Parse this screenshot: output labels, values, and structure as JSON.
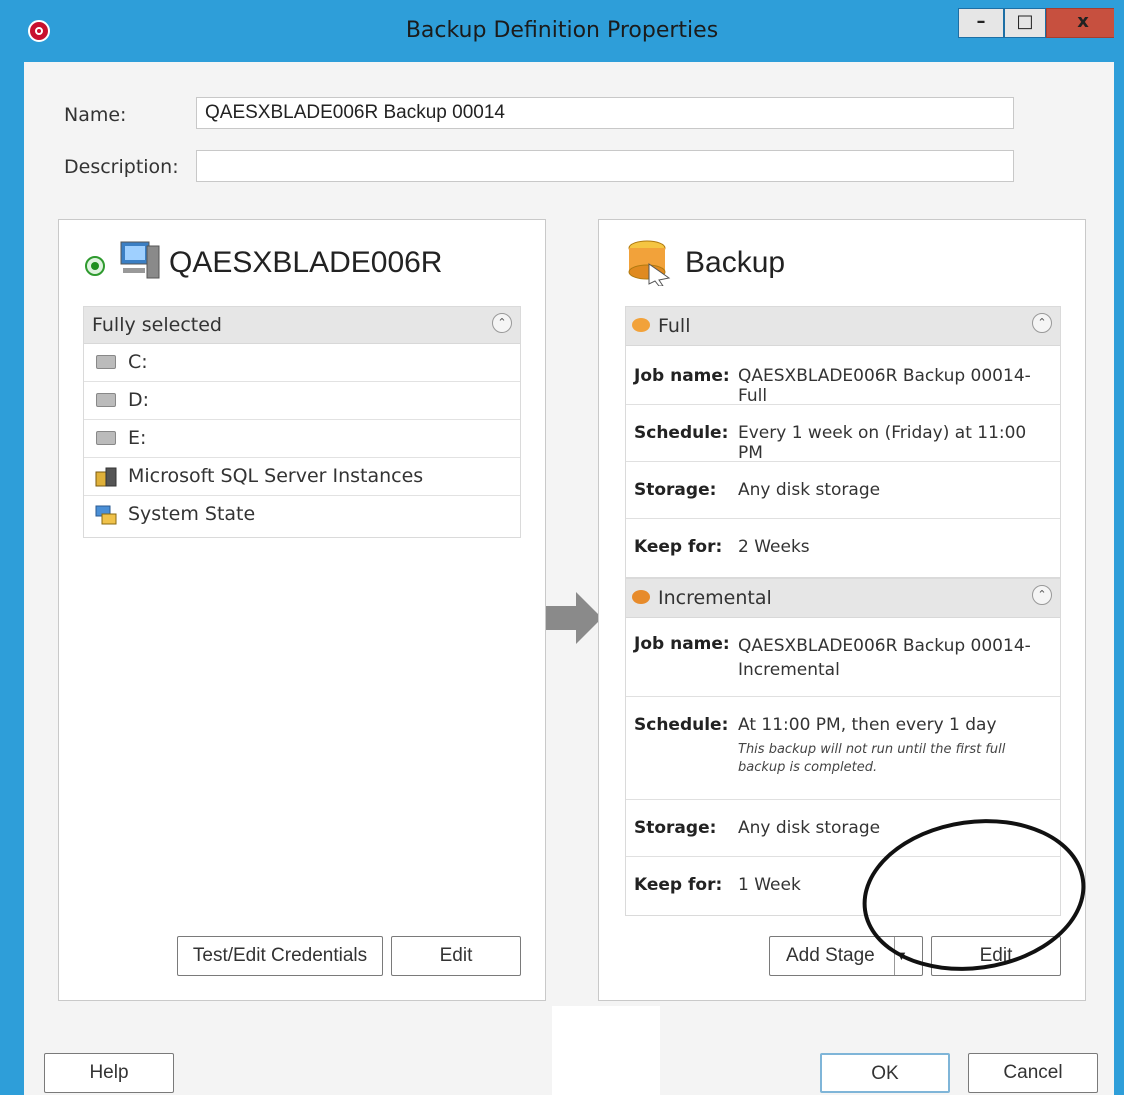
{
  "window": {
    "title": "Backup Definition Properties",
    "controls": {
      "minimize": "–",
      "maximize": "□",
      "close": "x"
    }
  },
  "form": {
    "name_label": "Name:",
    "name_value": "QAESXBLADE006R Backup 00014",
    "description_label": "Description:",
    "description_value": ""
  },
  "source": {
    "title": "QAESXBLADE006R",
    "status_icon": "green-radio-icon",
    "list_header": "Fully selected",
    "items": [
      {
        "label": "C:",
        "icon": "drive-icon"
      },
      {
        "label": "D:",
        "icon": "drive-icon"
      },
      {
        "label": "E:",
        "icon": "drive-icon"
      },
      {
        "label": "Microsoft SQL Server Instances",
        "icon": "database-icon"
      },
      {
        "label": "System State",
        "icon": "system-state-icon"
      }
    ],
    "buttons": {
      "test_edit": "Test/Edit Credentials",
      "edit": "Edit"
    }
  },
  "backup": {
    "title": "Backup",
    "stages": [
      {
        "name": "Full",
        "props": [
          {
            "key": "Job name:",
            "value": "QAESXBLADE006R Backup 00014-Full"
          },
          {
            "key": "Schedule:",
            "value": "Every 1 week on (Friday) at 11:00 PM"
          },
          {
            "key": "Storage:",
            "value": "Any disk storage"
          },
          {
            "key": "Keep for:",
            "value": "2 Weeks"
          }
        ]
      },
      {
        "name": "Incremental",
        "props": [
          {
            "key": "Job name:",
            "value": "QAESXBLADE006R Backup 00014-Incremental"
          },
          {
            "key": "Schedule:",
            "value": "At 11:00 PM, then every 1 day",
            "note": "This backup will not run until the first full backup is completed."
          },
          {
            "key": "Storage:",
            "value": "Any disk storage"
          },
          {
            "key": "Keep for:",
            "value": "1 Week"
          }
        ]
      }
    ],
    "buttons": {
      "add_stage": "Add Stage",
      "edit": "Edit"
    }
  },
  "footer": {
    "help": "Help",
    "ok": "OK",
    "cancel": "Cancel"
  },
  "colors": {
    "titlebar": "#2e9ed9",
    "close": "#c7503f",
    "accent": "#f2a23a"
  }
}
